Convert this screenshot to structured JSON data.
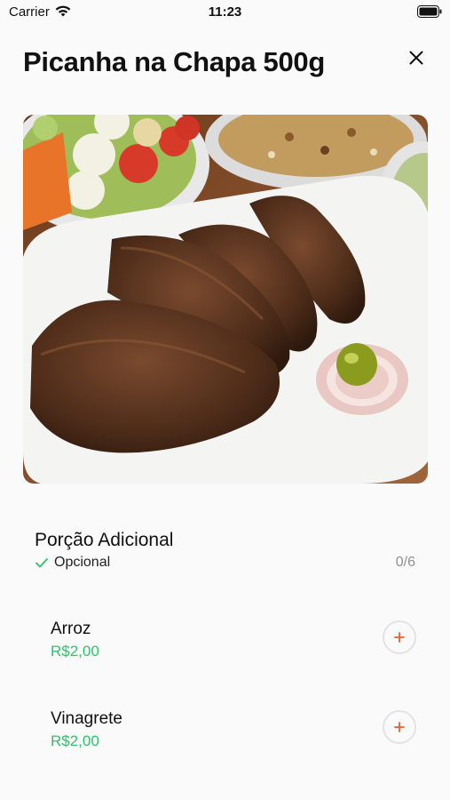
{
  "status_bar": {
    "carrier": "Carrier",
    "time": "11:23"
  },
  "header": {
    "title": "Picanha na Chapa 500g"
  },
  "icons": {
    "close": "close-icon",
    "wifi": "wifi-icon",
    "battery": "battery-icon",
    "check": "check-icon",
    "plus": "plus-icon"
  },
  "section": {
    "title": "Porção Adicional",
    "optional_label": "Opcional",
    "counter": "0/6"
  },
  "items": [
    {
      "name": "Arroz",
      "price": "R$2,00"
    },
    {
      "name": "Vinagrete",
      "price": "R$2,00"
    }
  ],
  "colors": {
    "price_green": "#2fc36b",
    "plus_orange": "#e8622c",
    "check_green": "#2fc36b"
  }
}
